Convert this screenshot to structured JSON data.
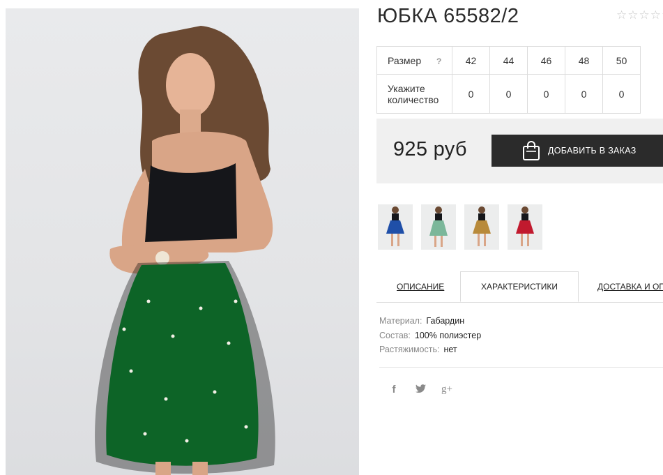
{
  "product": {
    "title": "ЮБКА 65582/2",
    "rating_stars": [
      "☆",
      "☆",
      "☆",
      "☆",
      "☆"
    ]
  },
  "sizes": {
    "size_label": "Размер",
    "help": "?",
    "values": [
      "42",
      "44",
      "46",
      "48",
      "50"
    ],
    "qty_label_line1": "Укажите",
    "qty_label_line2": "количество",
    "quantities": [
      "0",
      "0",
      "0",
      "0",
      "0"
    ]
  },
  "purchase": {
    "price": "925 руб",
    "order_button": "ДОБАВИТЬ В ЗАКАЗ"
  },
  "thumbnails": [
    {
      "color": "#1f4fa8",
      "name": "blue"
    },
    {
      "color": "#7bb79a",
      "name": "mint"
    },
    {
      "color": "#b88a3a",
      "name": "gold"
    },
    {
      "color": "#c11a2e",
      "name": "red"
    }
  ],
  "tabs": {
    "description": "ОПИСАНИЕ",
    "characteristics": "ХАРАКТЕРИСТИКИ",
    "delivery": "ДОСТАВКА И ОПЛАТА"
  },
  "specs": [
    {
      "key": "Материал:",
      "value": "Габардин"
    },
    {
      "key": "Состав:",
      "value": "100% полиэстер"
    },
    {
      "key": "Растяжимость:",
      "value": "нет"
    }
  ],
  "social": {
    "facebook": "f",
    "twitter": "🐦",
    "google": "g+"
  },
  "colors": {
    "skirt": "#159a3c",
    "button_bg": "#2b2b2b",
    "price_bar_bg": "#f0f0f0"
  }
}
